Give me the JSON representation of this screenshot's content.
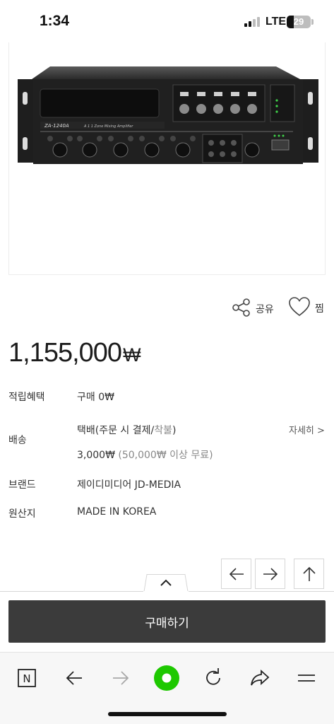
{
  "status": {
    "time": "1:34",
    "network": "LTE",
    "battery": "29",
    "battery_level": 0.29
  },
  "product": {
    "image_caption": "ZA-1240A",
    "image_subcaption": "A 1 1 Zone Mixing Amplifier"
  },
  "actions": {
    "share_label": "공유",
    "wish_label": "찜"
  },
  "price": {
    "amount": "1,155,000",
    "currency": "₩"
  },
  "info": {
    "points_label": "적립혜택",
    "points_value": "구매 0₩",
    "shipping_label": "배송",
    "shipping_method": "택배(주문 시 결제/",
    "shipping_method_gray": "착불",
    "shipping_method_end": ")",
    "shipping_fee": "3,000₩",
    "shipping_fee_note": "(50,000₩ 이상 무료)",
    "detail_link": "자세히 >",
    "brand_label": "브랜드",
    "brand_value": "제이디미디어 JD-MEDIA",
    "origin_label": "원산지",
    "origin_value": "MADE IN KOREA"
  },
  "buy_button": "구매하기",
  "toolbar": {
    "n_label": "N"
  },
  "colors": {
    "buy_button_bg": "#3b3b3b",
    "browser_accent": "#1ec800"
  }
}
